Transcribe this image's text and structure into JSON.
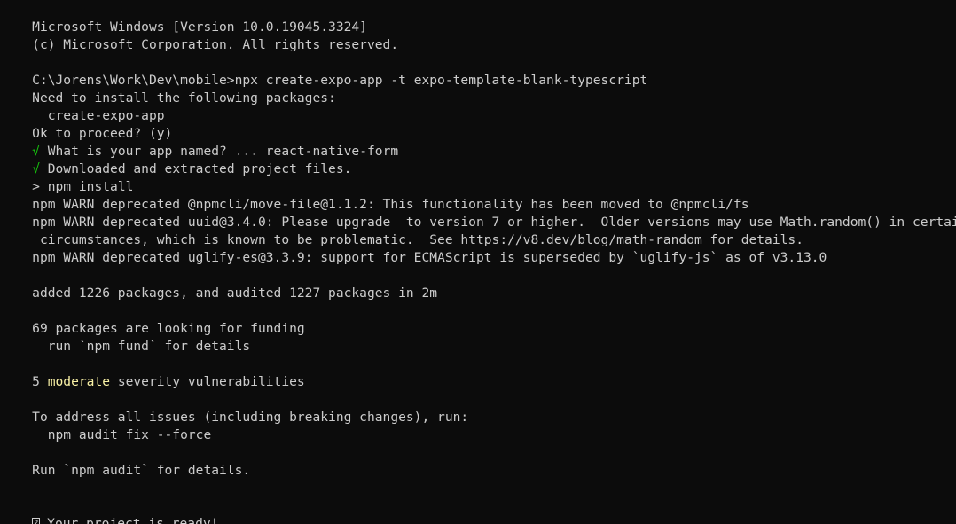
{
  "terminal": {
    "background": "#0c0c0c",
    "foreground": "#cccccc",
    "success_color": "#16c60c",
    "warning_color": "#f9f1a5",
    "lines": {
      "banner_version": "Microsoft Windows [Version 10.0.19045.3324]",
      "banner_copyright": "(c) Microsoft Corporation. All rights reserved.",
      "command_prompt": "C:\\Jorens\\Work\\Dev\\mobile>",
      "command_text": "npx create-expo-app -t expo-template-blank-typescript",
      "need_install": "Need to install the following packages:",
      "package_name": "  create-expo-app",
      "ok_proceed": "Ok to proceed? (y)",
      "check_mark_1": "√",
      "question_app_name": " What is your app named?",
      "question_dots": " ...",
      "app_name_answer": " react-native-form",
      "check_mark_2": "√",
      "downloaded_text": " Downloaded and extracted project files.",
      "npm_install_marker": ">",
      "npm_install_text": " npm install",
      "warn_1": "npm WARN deprecated @npmcli/move-file@1.1.2: This functionality has been moved to @npmcli/fs",
      "warn_2": "npm WARN deprecated uuid@3.4.0: Please upgrade  to version 7 or higher.  Older versions may use Math.random() in certain",
      "warn_2_cont": " circumstances, which is known to be problematic.  See https://v8.dev/blog/math-random for details.",
      "warn_3": "npm WARN deprecated uglify-es@3.3.9: support for ECMAScript is superseded by `uglify-js` as of v3.13.0",
      "added_packages": "added 1226 packages, and audited 1227 packages in 2m",
      "funding_count": "69 packages are looking for funding",
      "funding_run": "  run `npm fund` for details",
      "vuln_count": "5 ",
      "vuln_level": "moderate",
      "vuln_text": " severity vulnerabilities",
      "address_issues": "To address all issues (including breaking changes), run:",
      "audit_fix_cmd": "  npm audit fix --force",
      "run_audit": "Run `npm audit` for details.",
      "ready_text": "Your project is ready!"
    }
  }
}
